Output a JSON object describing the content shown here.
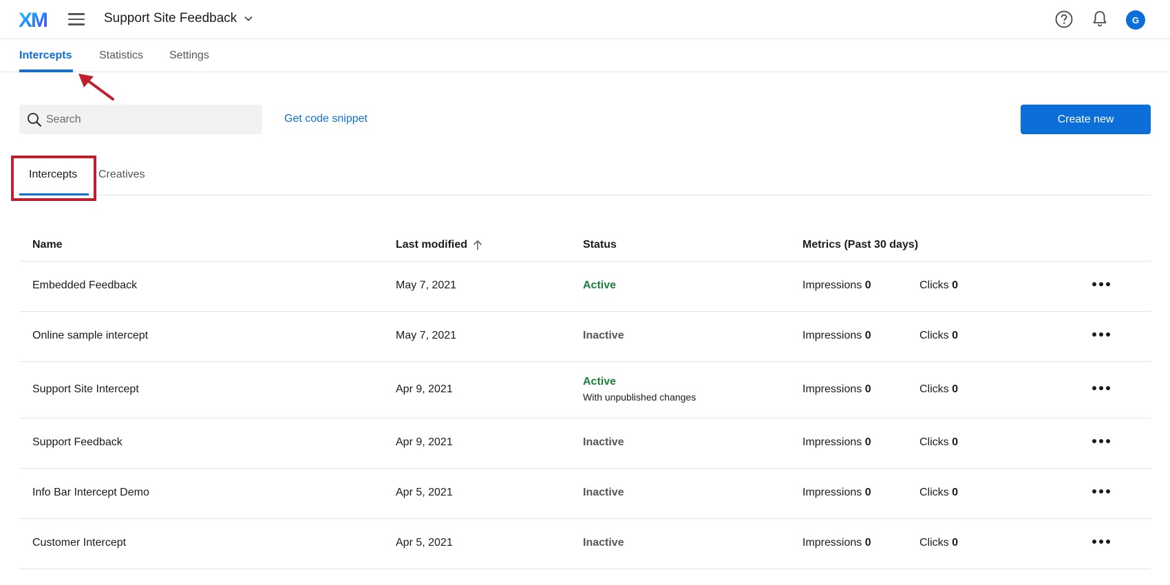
{
  "header": {
    "logo": "XM",
    "project_title": "Support Site Feedback",
    "avatar_initial": "G",
    "icons": [
      "menu-icon",
      "chevron-down-icon",
      "help-icon",
      "bell-icon"
    ]
  },
  "nav": {
    "tabs": [
      {
        "label": "Intercepts",
        "active": true
      },
      {
        "label": "Statistics",
        "active": false
      },
      {
        "label": "Settings",
        "active": false
      }
    ]
  },
  "toolbar": {
    "search_placeholder": "Search",
    "code_link": "Get code snippet",
    "create_label": "Create new"
  },
  "content_tabs": [
    {
      "label": "Intercepts",
      "active": true
    },
    {
      "label": "Creatives",
      "active": false
    }
  ],
  "table": {
    "columns": {
      "name": "Name",
      "modified": "Last modified",
      "status": "Status",
      "metrics": "Metrics (Past 30 days)"
    },
    "metric_labels": {
      "impressions": "Impressions",
      "clicks": "Clicks"
    },
    "rows": [
      {
        "name": "Embedded Feedback",
        "modified": "May 7, 2021",
        "status": "Active",
        "status_note": "",
        "impressions": "0",
        "clicks": "0"
      },
      {
        "name": "Online sample intercept",
        "modified": "May 7, 2021",
        "status": "Inactive",
        "status_note": "",
        "impressions": "0",
        "clicks": "0"
      },
      {
        "name": "Support Site Intercept",
        "modified": "Apr 9, 2021",
        "status": "Active",
        "status_note": "With unpublished changes",
        "impressions": "0",
        "clicks": "0"
      },
      {
        "name": "Support Feedback",
        "modified": "Apr 9, 2021",
        "status": "Inactive",
        "status_note": "",
        "impressions": "0",
        "clicks": "0"
      },
      {
        "name": "Info Bar Intercept Demo",
        "modified": "Apr 5, 2021",
        "status": "Inactive",
        "status_note": "",
        "impressions": "0",
        "clicks": "0"
      },
      {
        "name": "Customer Intercept",
        "modified": "Apr 5, 2021",
        "status": "Inactive",
        "status_note": "",
        "impressions": "0",
        "clicks": "0"
      }
    ]
  },
  "colors": {
    "accent": "#0b6ed9",
    "active_status": "#1a7f37",
    "annotation": "#c0202e"
  }
}
